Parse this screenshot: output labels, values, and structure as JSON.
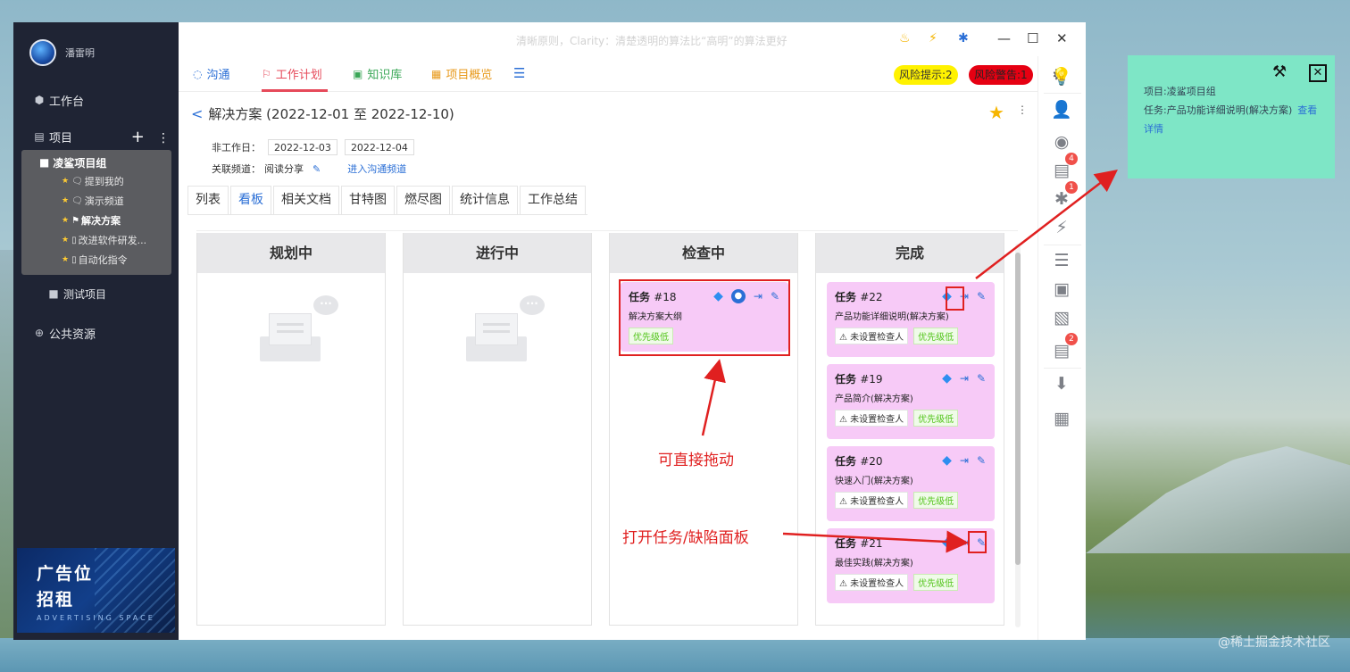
{
  "window": {
    "title": "清晰原则，Clarity：清楚透明的算法比“高明”的算法更好",
    "controls": {
      "minimize": "—",
      "maximize": "☐",
      "close": "✕"
    }
  },
  "sidebar": {
    "username": "潘雷明",
    "workbench": "工作台",
    "projects_label": "项目",
    "group_title": "凌鲨项目组",
    "group_items": [
      "提到我的",
      "演示频道",
      "解决方案",
      "改进软件研发...",
      "自动化指令"
    ],
    "test_project": "测试项目",
    "public": "公共资源",
    "ad": {
      "line1": "广告位",
      "line2": "招租",
      "line3": "ADVERTISING SPACE"
    }
  },
  "topnav": {
    "tabs": [
      "沟通",
      "工作计划",
      "知识库",
      "项目概览"
    ],
    "risk_tip": "风险提示:2",
    "risk_alert": "风险警告:1"
  },
  "page": {
    "back": "<",
    "title": "解决方案 (2022-12-01 至 2022-12-10)",
    "nonwork_label": "非工作日：",
    "nonwork_dates": [
      "2022-12-03",
      "2022-12-04"
    ],
    "channel_label": "关联频道：",
    "channel_value": "阅读分享",
    "channel_link": "进入沟通频道",
    "subtabs": [
      "列表",
      "看板",
      "相关文档",
      "甘特图",
      "燃尽图",
      "统计信息",
      "工作总结"
    ]
  },
  "board": {
    "columns": [
      "规划中",
      "进行中",
      "检查中",
      "完成"
    ],
    "checking_card": {
      "title_prefix": "任务",
      "num": "#18",
      "desc": "解决方案大纲",
      "priority": "优先级低"
    },
    "done_cards": [
      {
        "title_prefix": "任务",
        "num": "#22",
        "desc": "产品功能详细说明(解决方案)",
        "warn": "⚠ 未设置检查人",
        "priority": "优先级低"
      },
      {
        "title_prefix": "任务",
        "num": "#19",
        "desc": "产品简介(解决方案)",
        "warn": "⚠ 未设置检查人",
        "priority": "优先级低"
      },
      {
        "title_prefix": "任务",
        "num": "#20",
        "desc": "快速入门(解决方案)",
        "warn": "⚠ 未设置检查人",
        "priority": "优先级低"
      },
      {
        "title_prefix": "任务",
        "num": "#21",
        "desc": "最佳实践(解决方案)",
        "warn": "⚠ 未设置检查人",
        "priority": "优先级低"
      }
    ]
  },
  "annotations": {
    "drag": "可直接拖动",
    "open_panel": "打开任务/缺陷面板"
  },
  "rail_badges": [
    "4",
    "1",
    "2"
  ],
  "popup": {
    "project": "项目:凌鲨项目组",
    "task": "任务:产品功能详细说明(解决方案)",
    "link": "查看详情"
  },
  "watermark": "@稀土掘金技术社区",
  "colors": {
    "accent": "#e64a5a",
    "link": "#2b6fd6",
    "card": "#f7caf7",
    "popup": "#7ee6c6"
  }
}
